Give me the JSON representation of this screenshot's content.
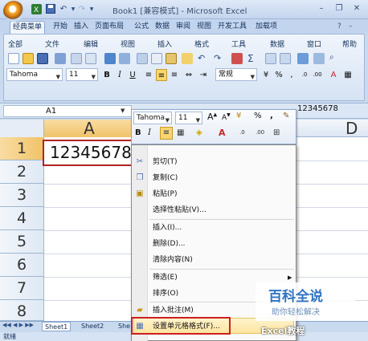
{
  "window": {
    "title": "Book1  [兼容模式] - Microsoft Excel",
    "minimize": "–",
    "restore": "❐",
    "close": "✕"
  },
  "tabs": [
    "经典菜单",
    "开始",
    "插入",
    "页面布局",
    "公式",
    "数据",
    "审阅",
    "视图",
    "开发工具",
    "加载项"
  ],
  "menus": [
    "全部",
    "文件",
    "编辑",
    "视图",
    "插入",
    "格式",
    "工具",
    "数据",
    "窗口",
    "帮助"
  ],
  "font": {
    "name": "Tahoma",
    "size": "11"
  },
  "number_format": "常规",
  "name_box": "A1",
  "formula_value": "12345678",
  "columns": [
    "A",
    "D"
  ],
  "rows": [
    "1",
    "2",
    "3",
    "4",
    "5",
    "6",
    "7",
    "8"
  ],
  "cell_a1": "12345678",
  "mini_toolbar": {
    "font": "Tahoma",
    "size": "11"
  },
  "context_menu": [
    {
      "label": "剪切(T)",
      "icon": "scissors-icon"
    },
    {
      "label": "复制(C)",
      "icon": "copy-icon"
    },
    {
      "label": "粘贴(P)",
      "icon": "paste-icon"
    },
    {
      "label": "选择性粘贴(V)...",
      "icon": ""
    },
    {
      "label": "插入(I)...",
      "icon": ""
    },
    {
      "label": "删除(D)...",
      "icon": ""
    },
    {
      "label": "清除内容(N)",
      "icon": ""
    },
    {
      "label": "筛选(E)",
      "icon": ""
    },
    {
      "label": "排序(O)",
      "icon": ""
    },
    {
      "label": "插入批注(M)",
      "icon": "comment-icon"
    },
    {
      "label": "设置单元格格式(F)...",
      "icon": "format-cells-icon"
    }
  ],
  "sheet_tabs": [
    "Sheet1",
    "Sheet2",
    "She"
  ],
  "status": "就绪",
  "watermark": {
    "title": "百科全说",
    "subtitle": "助你轻松解决",
    "brand": "Excel教程"
  },
  "colors": {
    "selection_red": "#cc1f1f",
    "ribbon_blue": "#c9d9ee",
    "highlight_gold": "#fde5a0"
  }
}
